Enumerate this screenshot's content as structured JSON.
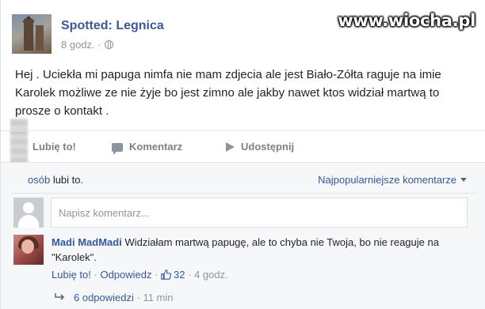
{
  "watermark": "www.wiocha.pl",
  "post": {
    "page_name": "Spotted: Legnica",
    "time": "8 godz. ·",
    "text": "Hej . Uciekła mi papuga nimfa nie mam zdjecia ale jest Biało-Zółta raguje na imie Karolek możliwe ze nie żyje bo jest zimno ale jakby nawet ktos widział martwą to prosze o kontakt ."
  },
  "actions": {
    "like_label": "Lubię to!",
    "comment_label": "Komentarz",
    "share_label": "Udostępnij"
  },
  "likes": {
    "osob": "osób",
    "suffix": " lubi to."
  },
  "sort": {
    "label": "Najpopularniejsze komentarze"
  },
  "comment_box": {
    "placeholder": "Napisz komentarz..."
  },
  "comment": {
    "author": "Madi MadMadi",
    "text": " Widziałam martwą papugę, ale to chyba nie Twoja, bo nie reaguje na \"Karolek\".",
    "like_link": "Lubię to!",
    "dot1": " · ",
    "reply_link": "Odpowiedz",
    "dot2": " · ",
    "likes_count": "32",
    "dot3": " · ",
    "time": "4 godz."
  },
  "replies": {
    "label": "6 odpowiedzi",
    "dot": " · ",
    "time": "11 min"
  },
  "icons": {
    "like": "thumbs-up-icon",
    "comment": "speech-bubble-icon",
    "share": "share-arrow-icon",
    "privacy": "globe-icon",
    "reply": "reply-arrow-icon"
  },
  "colors": {
    "link": "#365899",
    "page_name": "#3b5998",
    "muted": "#90949c"
  }
}
